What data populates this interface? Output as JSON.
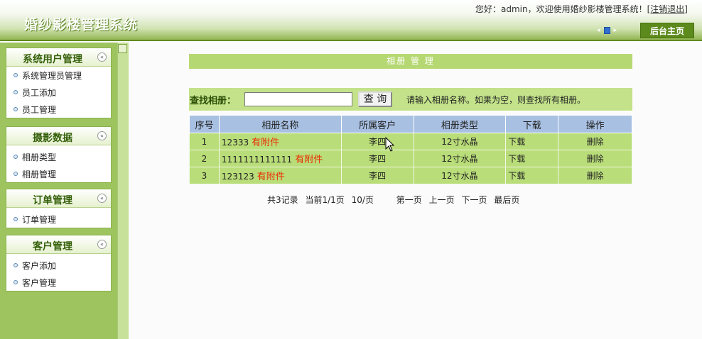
{
  "header": {
    "title": "婚纱影楼管理系统",
    "welcome": "您好：admin，欢迎使用婚纱影楼管理系统！",
    "logout": "[注销退出]",
    "home_button": "后台主页",
    "nav_left": "◂",
    "nav_right": "▸"
  },
  "sidebar": {
    "groups": [
      {
        "title": "系统用户管理",
        "items": [
          "系统管理员管理",
          "员工添加",
          "员工管理"
        ]
      },
      {
        "title": "摄影数据",
        "items": [
          "相册类型",
          "相册管理"
        ]
      },
      {
        "title": "订单管理",
        "items": [
          "订单管理"
        ]
      },
      {
        "title": "客户管理",
        "items": [
          "客户添加",
          "客户管理"
        ]
      }
    ],
    "collapse_glyph": "«"
  },
  "main": {
    "section_title": "相册 管 理",
    "search": {
      "label": "查找相册：",
      "value": "",
      "button": "查 询",
      "hint": "请输入相册名称。如果为空，则查找所有相册。"
    },
    "table": {
      "columns": [
        "序号",
        "相册名称",
        "所属客户",
        "相册类型",
        "下载",
        "操作"
      ],
      "rows": [
        {
          "index": "1",
          "name": "12333",
          "attach": "有附件",
          "customer": "李四",
          "type": "12寸水晶",
          "download": "下载",
          "action": "删除"
        },
        {
          "index": "2",
          "name": "1111111111111",
          "attach": "有附件",
          "customer": "李四",
          "type": "12寸水晶",
          "download": "下载",
          "action": "删除"
        },
        {
          "index": "3",
          "name": "123123",
          "attach": "有附件",
          "customer": "李四",
          "type": "12寸水晶",
          "download": "下载",
          "action": "删除"
        }
      ]
    },
    "pager": {
      "total": "共3记录",
      "current": "当前1/1页",
      "per_page": "10/页",
      "first": "第一页",
      "prev": "上一页",
      "next": "下一页",
      "last": "最后页"
    }
  },
  "colors": {
    "header_green": "#8fb34e",
    "sidebar_green": "#9dc45f",
    "row_green": "#b9dd79",
    "table_head_blue": "#a8c0e2",
    "attach_red": "#ea2a00"
  }
}
